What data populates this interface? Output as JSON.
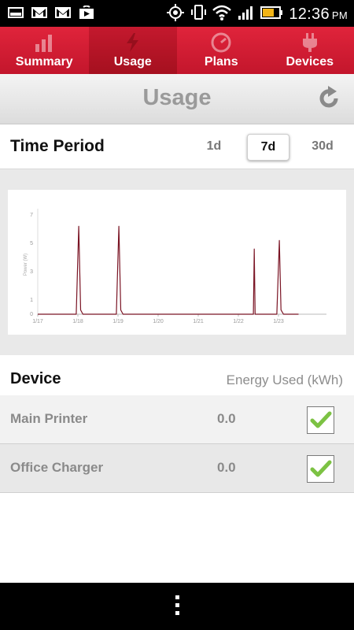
{
  "status_bar": {
    "time": "12:36",
    "ampm": "PM",
    "left_icons": [
      "gallery-icon",
      "gmail-icon",
      "gmail-icon",
      "play-store-icon"
    ],
    "right_icons": [
      "gps-icon",
      "vibrate-icon",
      "wifi-icon",
      "signal-icon",
      "battery-icon"
    ]
  },
  "tabs": [
    {
      "label": "Summary",
      "icon": "bar-chart-icon",
      "active": false
    },
    {
      "label": "Usage",
      "icon": "lightning-icon",
      "active": true
    },
    {
      "label": "Plans",
      "icon": "gauge-icon",
      "active": false
    },
    {
      "label": "Devices",
      "icon": "plug-icon",
      "active": false
    }
  ],
  "page": {
    "title": "Usage",
    "refresh_icon": "refresh-icon"
  },
  "period": {
    "label": "Time Period",
    "options": [
      "1d",
      "7d",
      "30d"
    ],
    "selected": "7d"
  },
  "chart_data": {
    "type": "line",
    "ylabel": "Power (W)",
    "ylim": [
      0,
      7
    ],
    "yticks": [
      "7",
      "5",
      "3",
      "1",
      "0"
    ],
    "xticks": [
      "1/17",
      "1/18",
      "1/19",
      "1/20",
      "1/21",
      "1/22",
      "1/23"
    ],
    "series": [
      {
        "color": "#7a1424",
        "x": [
          "1/17 00:00",
          "1/17 23:00",
          "1/18 00:30",
          "1/18 01:40",
          "1/18 03:00",
          "1/18 23:00",
          "1/19 00:30",
          "1/19 01:40",
          "1/19 03:00",
          "1/22 09:00",
          "1/22 09:30",
          "1/22 10:00",
          "1/22 23:00",
          "1/23 00:30",
          "1/23 01:30",
          "1/23 03:00",
          "1/23 12:00"
        ],
        "y": [
          0,
          0,
          6.2,
          0.3,
          0,
          0,
          6.2,
          0.3,
          0,
          0,
          4.6,
          0,
          0,
          5.2,
          0.3,
          0,
          0
        ]
      }
    ]
  },
  "table": {
    "col_device": "Device",
    "col_energy": "Energy Used (kWh)",
    "rows": [
      {
        "name": "Main Printer",
        "value": "0.0",
        "checked": true
      },
      {
        "name": "Office Charger",
        "value": "0.0",
        "checked": true
      }
    ]
  },
  "colors": {
    "tab_red": "#d41f35",
    "check_green": "#7cc243",
    "chart_line": "#7a1424"
  },
  "bottom_nav": {
    "menu_icon": "overflow-menu-icon"
  }
}
